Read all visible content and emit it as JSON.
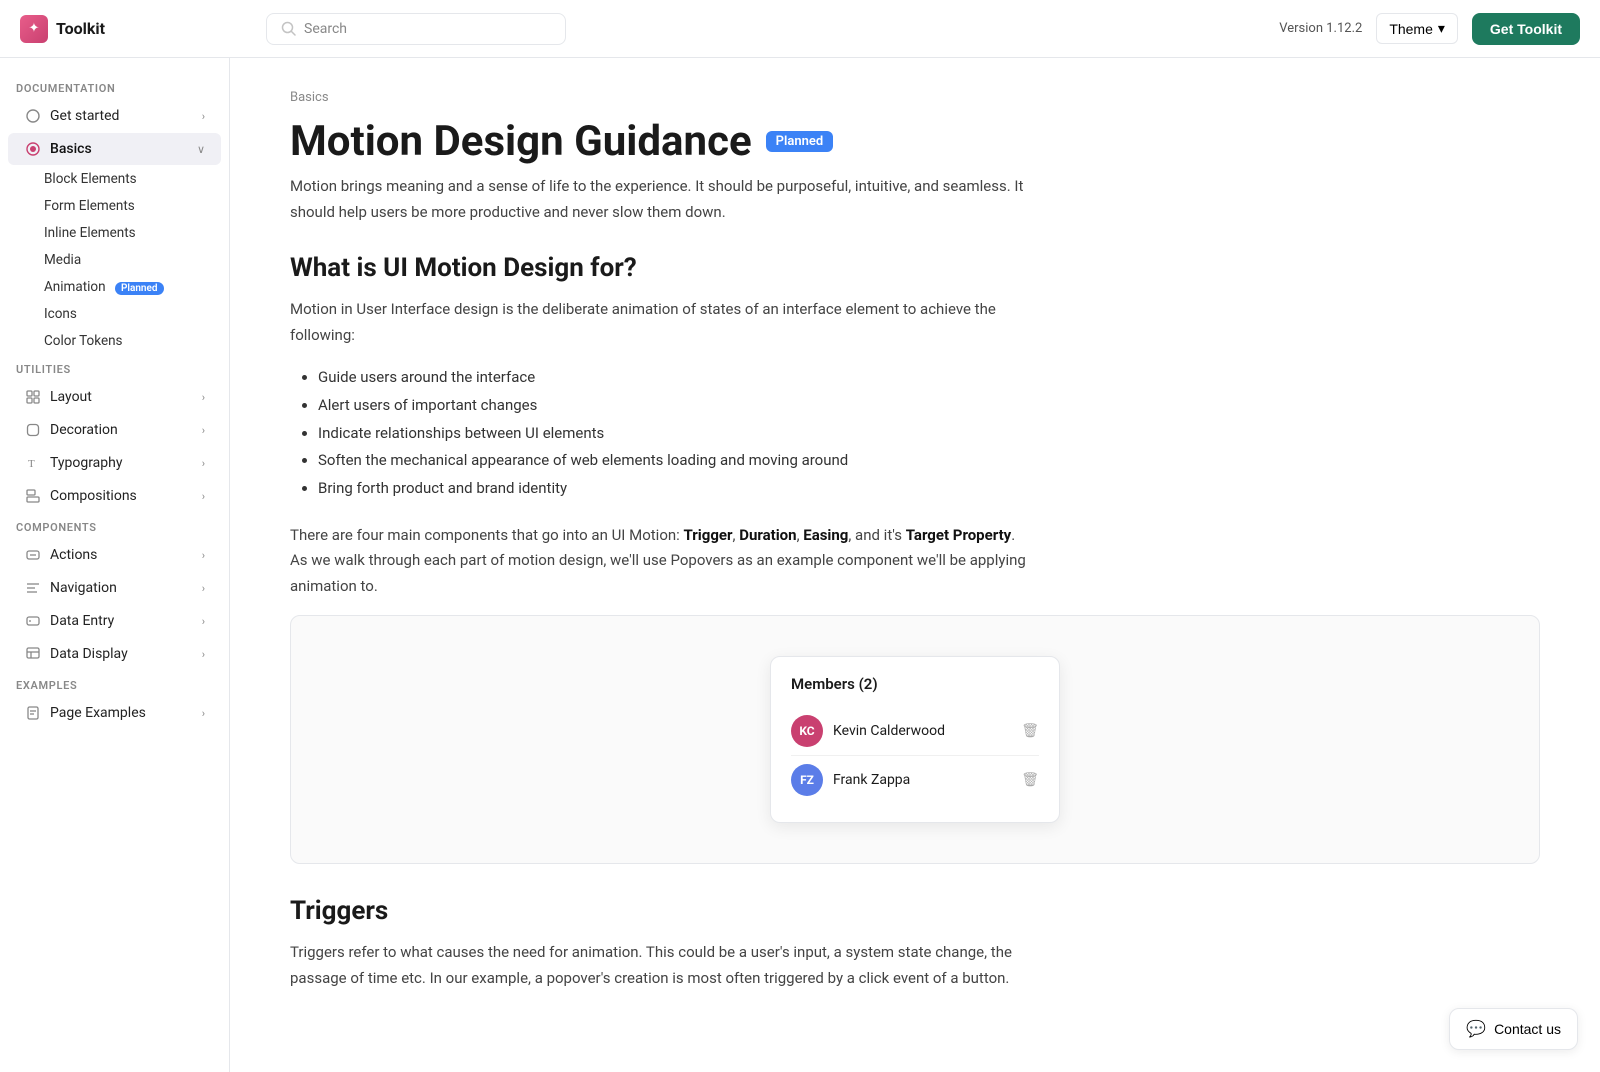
{
  "header": {
    "logo": "Toolkit",
    "search_placeholder": "Search",
    "version": "Version 1.12.2",
    "theme_label": "Theme",
    "get_toolkit_label": "Get Toolkit"
  },
  "sidebar": {
    "sections": [
      {
        "label": "Documentation",
        "items": [
          {
            "id": "get-started",
            "label": "Get started",
            "icon": "circle-icon",
            "has_children": true,
            "active": false
          },
          {
            "id": "basics",
            "label": "Basics",
            "icon": "circle-active-icon",
            "has_children": true,
            "active": true,
            "children": [
              {
                "id": "block-elements",
                "label": "Block Elements"
              },
              {
                "id": "form-elements",
                "label": "Form Elements"
              },
              {
                "id": "inline-elements",
                "label": "Inline Elements"
              },
              {
                "id": "media",
                "label": "Media"
              },
              {
                "id": "animation",
                "label": "Animation",
                "badge": "Planned"
              },
              {
                "id": "icons",
                "label": "Icons"
              },
              {
                "id": "color-tokens",
                "label": "Color Tokens"
              }
            ]
          }
        ]
      },
      {
        "label": "Utilities",
        "items": [
          {
            "id": "layout",
            "label": "Layout",
            "icon": "layout-icon",
            "has_children": true
          },
          {
            "id": "decoration",
            "label": "Decoration",
            "icon": "decoration-icon",
            "has_children": true
          },
          {
            "id": "typography",
            "label": "Typography",
            "icon": "typography-icon",
            "has_children": true
          },
          {
            "id": "compositions",
            "label": "Compositions",
            "icon": "compositions-icon",
            "has_children": true
          }
        ]
      },
      {
        "label": "Components",
        "items": [
          {
            "id": "actions",
            "label": "Actions",
            "icon": "actions-icon",
            "has_children": true
          },
          {
            "id": "navigation",
            "label": "Navigation",
            "icon": "navigation-icon",
            "has_children": true
          },
          {
            "id": "data-entry",
            "label": "Data Entry",
            "icon": "data-entry-icon",
            "has_children": true
          },
          {
            "id": "data-display",
            "label": "Data Display",
            "icon": "data-display-icon",
            "has_children": true
          }
        ]
      },
      {
        "label": "Examples",
        "items": [
          {
            "id": "page-examples",
            "label": "Page Examples",
            "icon": "page-examples-icon",
            "has_children": true
          }
        ]
      }
    ]
  },
  "main": {
    "breadcrumb": "Basics",
    "title": "Motion Design Guidance",
    "title_badge": "Planned",
    "intro": "Motion brings meaning and a sense of life to the experience. It should be purposeful, intuitive, and seamless. It should help users be more productive and never slow them down.",
    "section1_heading": "What is UI Motion Design for?",
    "section1_body": "Motion in User Interface design is the deliberate animation of states of an interface element to achieve the following:",
    "bullets": [
      "Guide users around the interface",
      "Alert users of important changes",
      "Indicate relationships between UI elements",
      "Soften the mechanical appearance of web elements loading and moving around",
      "Bring forth product and brand identity"
    ],
    "section1_extra": "There are four main components that go into an UI Motion: Trigger, Duration, Easing, and it's Target Property. As we walk through each part of motion design, we'll use Popovers as an example component we'll be applying animation to.",
    "popover_title": "Members (2)",
    "members": [
      {
        "id": "kc",
        "initials": "KC",
        "name": "Kevin Calderwood",
        "avatar_class": "kc"
      },
      {
        "id": "fz",
        "initials": "FZ",
        "name": "Frank Zappa",
        "avatar_class": "fz"
      }
    ],
    "section2_heading": "Triggers",
    "section2_body": "Triggers refer to what causes the need for animation. This could be a user's input, a system state change, the passage of time etc. In our example, a popover's creation is most often triggered by a click event of a button."
  },
  "contact": {
    "label": "Contact us"
  }
}
